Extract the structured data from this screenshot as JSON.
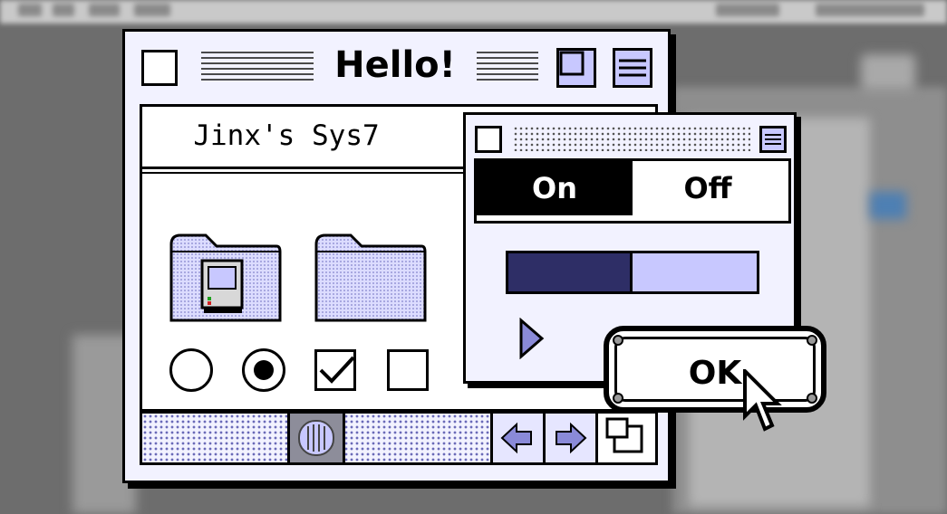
{
  "window": {
    "title": "Hello!",
    "header_label": "Jinx's Sys7"
  },
  "palette": {
    "toggle_on_label": "On",
    "toggle_off_label": "Off",
    "selected": "On",
    "progress_fraction": 0.5
  },
  "dialog": {
    "ok_label": "OK"
  },
  "controls": {
    "radio_1_selected": false,
    "radio_2_selected": true,
    "checkbox_1_checked": true,
    "checkbox_2_checked": false
  },
  "icons": [
    "close-box-icon",
    "zoom-box-icon",
    "collapse-box-icon",
    "computer-folder-icon",
    "folder-icon",
    "scroll-left-arrow-icon",
    "scroll-right-arrow-icon",
    "resize-box-icon",
    "disclosure-triangle-icon",
    "mouse-pointer-icon"
  ],
  "colors": {
    "lavender": "#c8c8ff",
    "window_bg": "#f2f2ff",
    "progress_dark": "#2e2e66",
    "desktop": "#6d6d6d"
  }
}
